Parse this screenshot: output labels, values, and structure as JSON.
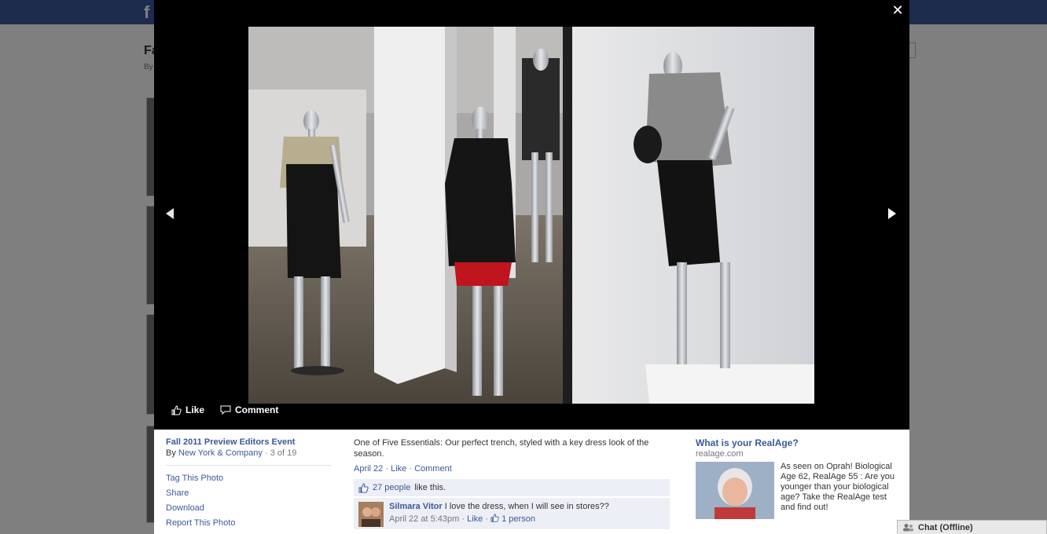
{
  "background": {
    "logo": "f",
    "page_title": "Fa",
    "page_sub": "By"
  },
  "lightbox": {
    "close_icon": "close-icon",
    "prev_icon": "arrow-left-icon",
    "next_icon": "arrow-right-icon",
    "stage_actions": {
      "like_label": "Like",
      "comment_label": "Comment"
    }
  },
  "album": {
    "title": "Fall 2011 Preview Editors Event",
    "by_prefix": "By",
    "owner": "New York & Company",
    "position": "· 3 of 19"
  },
  "photo_actions": [
    "Tag This Photo",
    "Share",
    "Download",
    "Report This Photo"
  ],
  "photo": {
    "caption": "One of Five Essentials: Our perfect trench, styled with a key dress look of the season.",
    "date": "April 22",
    "like_link": "Like",
    "comment_link": "Comment",
    "likes_count": "27 people",
    "likes_suffix": "like this."
  },
  "comments": [
    {
      "author": "Silmara Vitor",
      "text": "I love the dress, when I will see in stores??",
      "time": "April 22 at 5:43pm",
      "like_link": "Like",
      "like_count": "1 person"
    }
  ],
  "ad": {
    "title": "What is your RealAge?",
    "domain": "realage.com",
    "text": "As seen on Oprah! Biological Age 62, RealAge 55 : Are you younger than your biological age? Take the RealAge test and find out!"
  },
  "chat": {
    "label": "Chat (Offline)"
  },
  "colors": {
    "link": "#3b5998",
    "topbar": "#3b5998",
    "stage": "#000000",
    "likes_bg": "#eceff5"
  }
}
